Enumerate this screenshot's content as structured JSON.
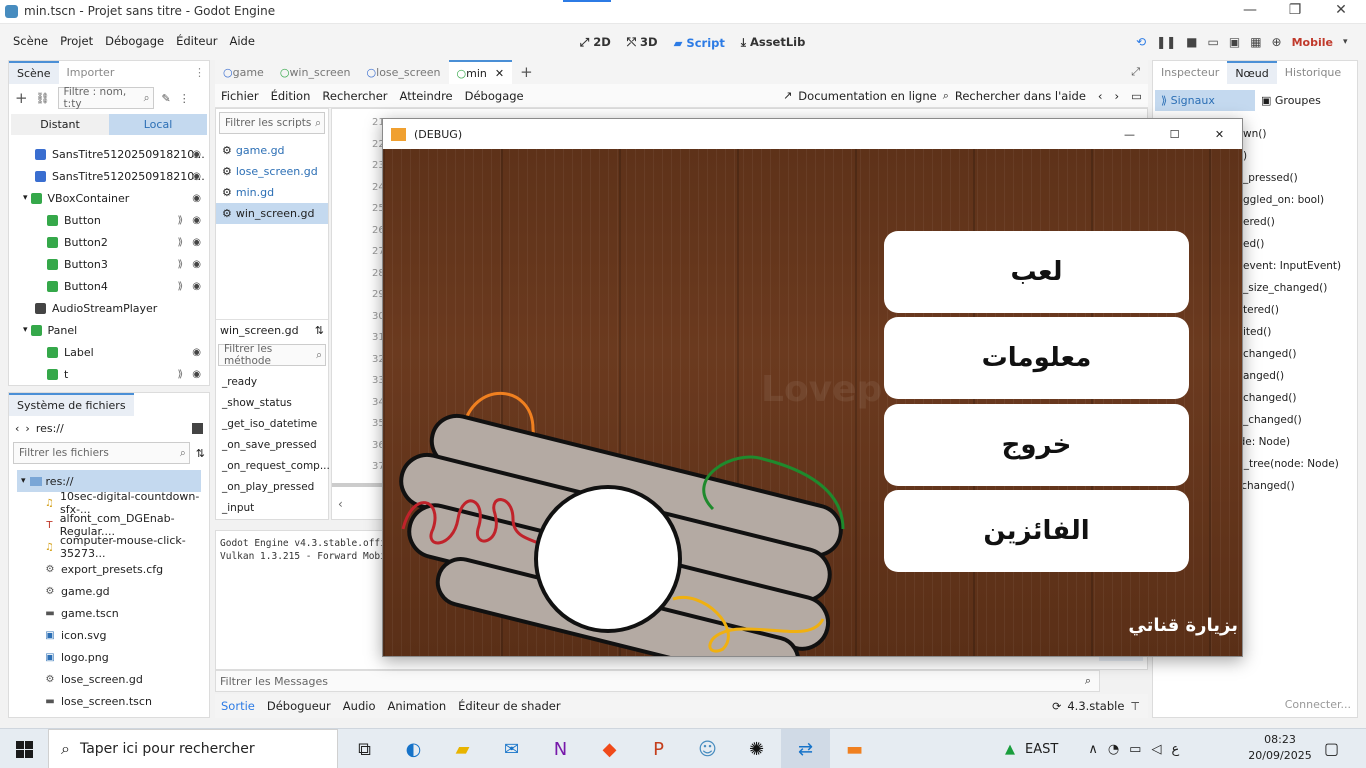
{
  "window": {
    "title": "min.tscn - Projet sans titre - Godot Engine",
    "controls": [
      "—",
      "❐",
      "✕"
    ]
  },
  "menu": [
    "Scène",
    "Projet",
    "Débogage",
    "Éditeur",
    "Aide"
  ],
  "workspaces": [
    {
      "label": "2D",
      "icon": "2d-icon"
    },
    {
      "label": "3D",
      "icon": "3d-icon"
    },
    {
      "label": "Script",
      "icon": "script-icon"
    },
    {
      "label": "AssetLib",
      "icon": "assetlib-icon"
    }
  ],
  "renderer": "Mobile",
  "scene_dock": {
    "tabs": [
      "Scène",
      "Importer"
    ],
    "filter_placeholder": "Filtre : nom, t:ty",
    "remote_local": [
      "Distant",
      "Local"
    ],
    "nodes": [
      {
        "name": "SansTitre5120250918210...",
        "type": "sprite",
        "indent": 1,
        "signal": false
      },
      {
        "name": "SansTitre5120250918210...",
        "type": "sprite",
        "indent": 1,
        "signal": false
      },
      {
        "name": "VBoxContainer",
        "type": "container",
        "indent": 1,
        "signal": false,
        "open": true
      },
      {
        "name": "Button",
        "type": "button",
        "indent": 2,
        "signal": true
      },
      {
        "name": "Button2",
        "type": "button",
        "indent": 2,
        "signal": true
      },
      {
        "name": "Button3",
        "type": "button",
        "indent": 2,
        "signal": true
      },
      {
        "name": "Button4",
        "type": "button",
        "indent": 2,
        "signal": true
      },
      {
        "name": "AudioStreamPlayer",
        "type": "audio",
        "indent": 1,
        "signal": false
      },
      {
        "name": "Panel",
        "type": "panel",
        "indent": 1,
        "signal": false,
        "open": true
      },
      {
        "name": "Label",
        "type": "label",
        "indent": 2,
        "signal": false
      },
      {
        "name": "t",
        "type": "button",
        "indent": 2,
        "signal": true
      }
    ]
  },
  "filesystem": {
    "tab": "Système de fichiers",
    "path": "res://",
    "filter_placeholder": "Filtrer les fichiers",
    "root": "res://",
    "files": [
      {
        "name": "10sec-digital-countdown-sfx-...",
        "icon": "audio-icon"
      },
      {
        "name": "alfont_com_DGEnab-Regular....",
        "icon": "font-icon"
      },
      {
        "name": "computer-mouse-click-35273...",
        "icon": "audio-icon"
      },
      {
        "name": "export_presets.cfg",
        "icon": "gear-icon"
      },
      {
        "name": "game.gd",
        "icon": "gear-icon"
      },
      {
        "name": "game.tscn",
        "icon": "scene-icon"
      },
      {
        "name": "icon.svg",
        "icon": "image-icon"
      },
      {
        "name": "logo.png",
        "icon": "image-icon"
      },
      {
        "name": "lose_screen.gd",
        "icon": "gear-icon"
      },
      {
        "name": "lose_screen.tscn",
        "icon": "scene-icon"
      }
    ]
  },
  "scene_tabs": [
    "game",
    "win_screen",
    "lose_screen",
    "min"
  ],
  "script_menu": [
    "Fichier",
    "Édition",
    "Rechercher",
    "Atteindre",
    "Débogage"
  ],
  "script_links": [
    "Documentation en ligne",
    "Rechercher dans l'aide"
  ],
  "script_list": {
    "filter_placeholder": "Filtrer les scripts",
    "items": [
      "game.gd",
      "lose_screen.gd",
      "min.gd",
      "win_screen.gd"
    ],
    "current": "win_screen.gd",
    "method_filter": "Filtrer les méthode",
    "methods": [
      "_ready",
      "_show_status",
      "_get_iso_datetime",
      "_on_save_pressed",
      "_on_request_comp...",
      "_on_play_pressed",
      "_input"
    ]
  },
  "line_numbers": [
    "21",
    "22",
    "23",
    "24",
    "25",
    "26",
    "27",
    "28",
    "29",
    "30",
    "31",
    "32",
    "33",
    "34",
    "35",
    "36",
    "37"
  ],
  "output": {
    "lines": [
      "Godot Engine v4.3.stable.offic",
      "Vulkan 1.3.215 - Forward Mobil"
    ],
    "filter_placeholder": "Filtrer les Messages",
    "counter": "0",
    "bottom_tabs": [
      "Sortie",
      "Débogueur",
      "Audio",
      "Animation",
      "Éditeur de shader"
    ],
    "version": "4.3.stable"
  },
  "inspector": {
    "tabs": [
      "Inspecteur",
      "Nœud",
      "Historique"
    ],
    "subtabs": [
      "Signaux",
      "Groupes"
    ],
    "signals": [
      "wn()",
      ")",
      "_pressed()",
      "ggled_on: bool)",
      "ered()",
      "ed()",
      "event: InputEvent)",
      "_size_changed()",
      "tered()",
      "ited()",
      "changed()",
      "anged()",
      "changed()",
      "_changed()",
      "red_tree(node: Node)",
      "child_exiting_tree(node: Node)",
      "child_order_changed()"
    ],
    "connect": "Connecter..."
  },
  "debug_window": {
    "title": "(DEBUG)",
    "buttons": [
      "لعب",
      "معلومات",
      "خروج",
      "الفائزين"
    ],
    "watermark": "بزيارة قناتي",
    "faint_text": "Lovep"
  },
  "taskbar": {
    "search_placeholder": "Taper ici pour rechercher",
    "apps": [
      "task-view-icon",
      "edge-icon",
      "explorer-icon",
      "mail-icon",
      "onenote-icon",
      "brave-icon",
      "powerpoint-icon",
      "godot-icon",
      "chatgpt-icon",
      "remote-icon",
      "game-icon"
    ],
    "market": "EAST",
    "lang": "ع",
    "time": "08:23",
    "date": "20/09/2025"
  }
}
